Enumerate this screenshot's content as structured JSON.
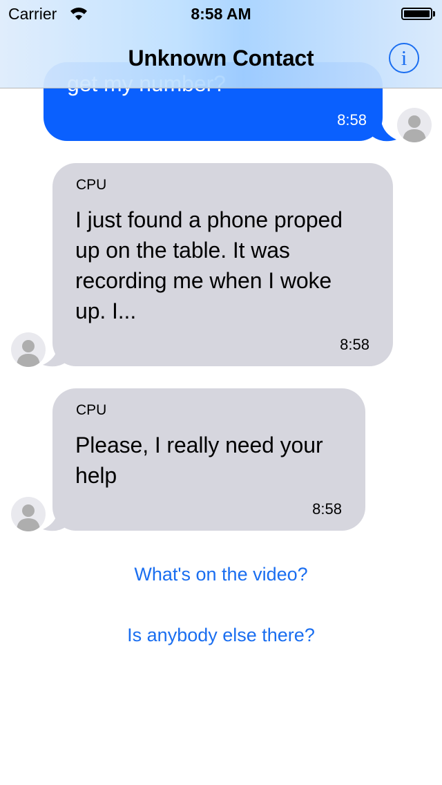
{
  "status_bar": {
    "carrier": "Carrier",
    "time": "8:58 AM"
  },
  "nav": {
    "title": "Unknown Contact",
    "info_glyph": "i"
  },
  "messages": [
    {
      "direction": "outgoing",
      "text": "get my number?",
      "time": "8:58"
    },
    {
      "direction": "incoming",
      "sender": "CPU",
      "lines": [
        "I just found a phone proped",
        "up on the table. It was",
        "recording me when I woke",
        "up. I..."
      ],
      "time": "8:58"
    },
    {
      "direction": "incoming",
      "sender": "CPU",
      "lines": [
        "Please, I really need your",
        "help"
      ],
      "time": "8:58"
    }
  ],
  "quick_replies": [
    "What's on the video?",
    "Is anybody else there?"
  ],
  "colors": {
    "outgoing_bubble": "#0a60fe",
    "incoming_bubble": "#d6d6de",
    "accent": "#1a6ef0"
  },
  "icons": [
    "wifi-icon",
    "battery-icon",
    "info-icon",
    "avatar-icon"
  ]
}
